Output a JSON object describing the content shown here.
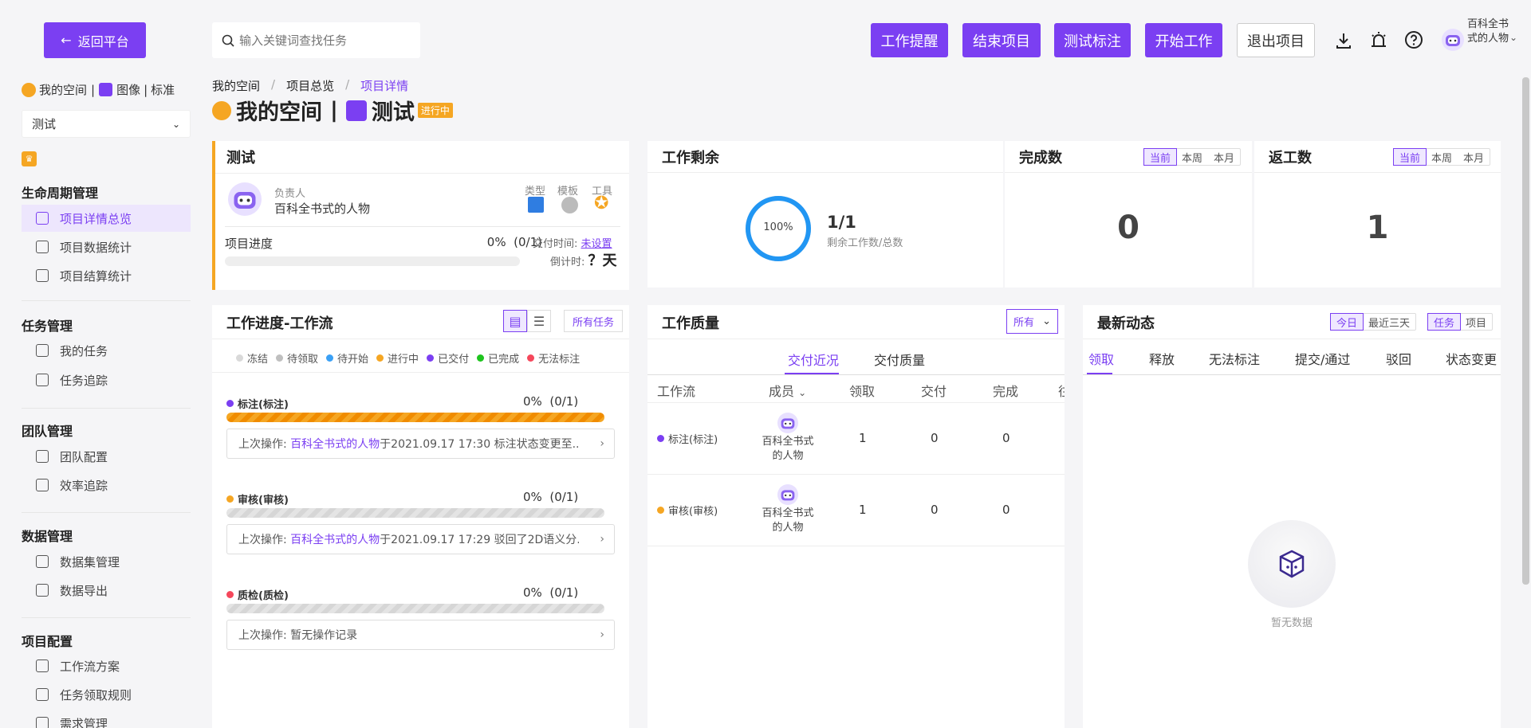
{
  "topbar": {
    "back_label": "返回平台",
    "search_placeholder": "输入关键词查找任务",
    "buttons": [
      "工作提醒",
      "结束项目",
      "测试标注",
      "开始工作"
    ],
    "exit_label": "退出项目",
    "user_name": "百科全书式的人物"
  },
  "sidebar": {
    "space_label": "我的空间",
    "sep": "|",
    "type_label": "图像",
    "std_label": "标准",
    "project_select": "测试",
    "sections": [
      {
        "title": "生命周期管理",
        "items": [
          "项目详情总览",
          "项目数据统计",
          "项目结算统计"
        ]
      },
      {
        "title": "任务管理",
        "items": [
          "我的任务",
          "任务追踪"
        ]
      },
      {
        "title": "团队管理",
        "items": [
          "团队配置",
          "效率追踪"
        ]
      },
      {
        "title": "数据管理",
        "items": [
          "数据集管理",
          "数据导出"
        ]
      },
      {
        "title": "项目配置",
        "items": [
          "工作流方案",
          "任务领取规则",
          "需求管理"
        ]
      }
    ]
  },
  "breadcrumb": [
    "我的空间",
    "/",
    "项目总览",
    "/",
    "项目详情"
  ],
  "page_title": {
    "space": "我的空间",
    "sep": "|",
    "project": "测试",
    "status": "进行中"
  },
  "info_card": {
    "title": "测试",
    "owner_label": "负责人",
    "owner_name": "百科全书式的人物",
    "type_label": "类型",
    "template_label": "模板",
    "tool_label": "工具",
    "progress_label": "项目进度",
    "progress_value": "0%",
    "progress_count": "(0/1)",
    "progress_fraction": 0,
    "delivery_label": "交付时间:",
    "delivery_value": "未设置",
    "countdown_label": "倒计时:",
    "countdown_value": "？天"
  },
  "remaining": {
    "title": "工作剩余",
    "percent": "100%",
    "ratio": "1/1",
    "caption": "剩余工作数/总数",
    "fraction": 1.0
  },
  "completed": {
    "title": "完成数",
    "tabs": [
      "当前",
      "本周",
      "本月"
    ],
    "value": "0"
  },
  "rework": {
    "title": "返工数",
    "tabs": [
      "当前",
      "本周",
      "本月"
    ],
    "value": "1"
  },
  "workflow": {
    "title": "工作进度-工作流",
    "all_tasks": "所有任务",
    "legend": [
      {
        "label": "冻结",
        "color": "#d9d9d9"
      },
      {
        "label": "待领取",
        "color": "#bfbfbf"
      },
      {
        "label": "待开始",
        "color": "#3aa0f5"
      },
      {
        "label": "进行中",
        "color": "#f5a623"
      },
      {
        "label": "已交付",
        "color": "#7b3ff2"
      },
      {
        "label": "已完成",
        "color": "#1ec41e"
      },
      {
        "label": "无法标注",
        "color": "#f5475b"
      }
    ],
    "items": [
      {
        "name": "标注(标注)",
        "dot": "#7b3ff2",
        "pct": "0%",
        "count": "(0/1)",
        "bar": "orange",
        "op_prefix": "上次操作:",
        "op_user": "百科全书式的人物",
        "op_text": "于2021.09.17 17:30 标注状态变更至..."
      },
      {
        "name": "审核(审核)",
        "dot": "#f5a623",
        "pct": "0%",
        "count": "(0/1)",
        "bar": "grey",
        "op_prefix": "上次操作:",
        "op_user": "百科全书式的人物",
        "op_text": "于2021.09.17 17:29 驳回了2D语义分..."
      },
      {
        "name": "质检(质检)",
        "dot": "#f5475b",
        "pct": "0%",
        "count": "(0/1)",
        "bar": "grey",
        "op_prefix": "上次操作:",
        "op_user": "",
        "op_text": "暂无操作记录"
      }
    ]
  },
  "quality": {
    "title": "工作质量",
    "filter": "所有",
    "tabs": [
      "交付近况",
      "交付质量"
    ],
    "columns": [
      "工作流",
      "成员",
      "领取",
      "交付",
      "完成",
      "往"
    ],
    "rows": [
      {
        "flow": "标注(标注)",
        "dot": "#7b3ff2",
        "member": "百科全书式的人物",
        "take": "1",
        "deliver": "0",
        "done": "0"
      },
      {
        "flow": "审核(审核)",
        "dot": "#f5a623",
        "member": "百科全书式的人物",
        "take": "1",
        "deliver": "0",
        "done": "0"
      }
    ]
  },
  "news": {
    "title": "最新动态",
    "range_tabs": [
      "今日",
      "最近三天"
    ],
    "scope_tabs": [
      "任务",
      "项目"
    ],
    "tabs": [
      "领取",
      "释放",
      "无法标注",
      "提交/通过",
      "驳回",
      "状态变更"
    ],
    "empty": "暂无数据"
  }
}
